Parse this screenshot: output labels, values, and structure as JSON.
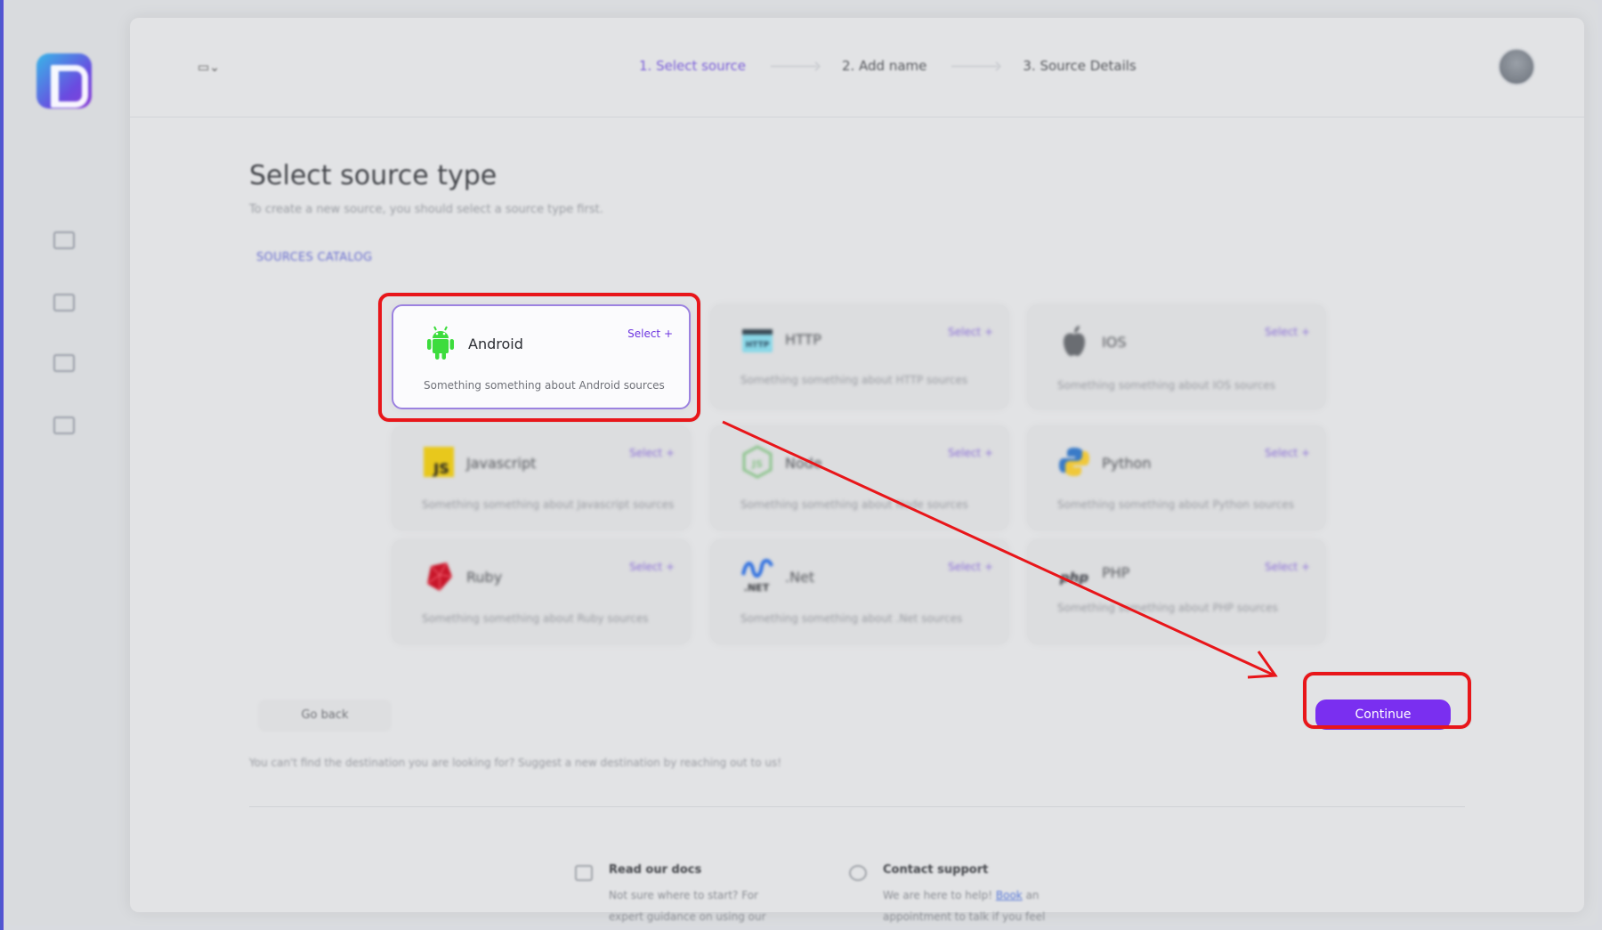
{
  "app": {
    "logo": "logo-icon"
  },
  "sidebar": {
    "items": [
      {
        "icon": "file-export-icon"
      },
      {
        "icon": "folder-settings-icon"
      },
      {
        "icon": "folder-open-icon"
      },
      {
        "icon": "folder-search-icon"
      }
    ]
  },
  "header": {
    "folder_switch": "▭⌄",
    "steps": [
      {
        "label": "1. Select source",
        "active": true
      },
      {
        "label": "2. Add name",
        "active": false
      },
      {
        "label": "3. Source Details",
        "active": false
      }
    ]
  },
  "page": {
    "title": "Select source type",
    "subtitle": "To create a new source, you should select a source type first.",
    "catalog_label": "SOURCES CATALOG"
  },
  "sources": [
    {
      "name": "Android",
      "select": "Select +",
      "desc": "Something something about Android sources",
      "icon": "android-icon",
      "selected": true
    },
    {
      "name": "HTTP",
      "select": "Select +",
      "desc": "Something something about HTTP sources",
      "icon": "http-icon",
      "selected": false
    },
    {
      "name": "IOS",
      "select": "Select +",
      "desc": "Something something about IOS sources",
      "icon": "apple-icon",
      "selected": false
    },
    {
      "name": "Javascript",
      "select": "Select +",
      "desc": "Something something about Javascript sources",
      "icon": "javascript-icon",
      "selected": false
    },
    {
      "name": "Node",
      "select": "Select +",
      "desc": "Something something about Node sources",
      "icon": "nodejs-icon",
      "selected": false
    },
    {
      "name": "Python",
      "select": "Select +",
      "desc": "Something something about Python sources",
      "icon": "python-icon",
      "selected": false
    },
    {
      "name": "Ruby",
      "select": "Select +",
      "desc": "Something something about Ruby sources",
      "icon": "ruby-icon",
      "selected": false
    },
    {
      "name": ".Net",
      "select": "Select +",
      "desc": "Something something about .Net sources",
      "icon": "dotnet-icon",
      "selected": false
    },
    {
      "name": "PHP",
      "select": "Select +",
      "desc": "Something something about PHP sources",
      "icon": "php-icon",
      "selected": false
    }
  ],
  "actions": {
    "go_back": "Go back",
    "continue": "Continue"
  },
  "footer": {
    "note": "You can't find the destination you are looking for? Suggest a new destination by reaching out to us!",
    "docs_title": "Read our docs",
    "docs_text": "Not sure where to start? For expert guidance on using our",
    "support_title": "Contact support",
    "support_text_before": "We are here to help!",
    "support_link": "Book",
    "support_text_after": "an appointment to talk if you feel"
  },
  "colors": {
    "accent": "#7a2ff0",
    "annotation": "#e8161a",
    "selected_border": "#9c82e0"
  }
}
